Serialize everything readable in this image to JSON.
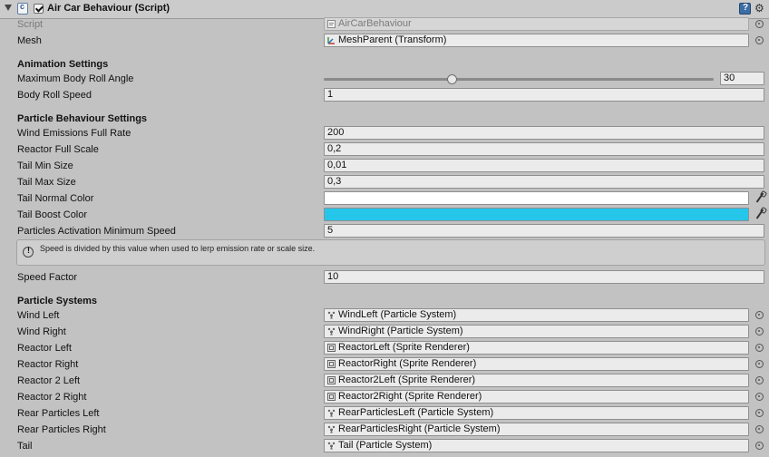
{
  "component": {
    "title": "Air Car Behaviour (Script)",
    "script_label": "Script",
    "script_value": "AirCarBehaviour",
    "mesh_label": "Mesh",
    "mesh_value": "MeshParent (Transform)"
  },
  "animation": {
    "header": "Animation Settings",
    "roll_angle_label": "Maximum Body Roll Angle",
    "roll_angle_value": "30",
    "roll_angle_slider_fraction": 0.33,
    "roll_speed_label": "Body Roll Speed",
    "roll_speed_value": "1"
  },
  "particle_behaviour": {
    "header": "Particle Behaviour Settings",
    "fields": [
      {
        "label": "Wind Emissions Full Rate",
        "value": "200"
      },
      {
        "label": "Reactor Full Scale",
        "value": "0,2"
      },
      {
        "label": "Tail Min Size",
        "value": "0,01"
      },
      {
        "label": "Tail Max Size",
        "value": "0,3"
      }
    ],
    "tail_normal_color_label": "Tail Normal Color",
    "tail_normal_color": "#ffffff",
    "tail_boost_color_label": "Tail Boost Color",
    "tail_boost_color": "#26c6eb",
    "activation_speed_label": "Particles Activation Minimum Speed",
    "activation_speed_value": "5",
    "help_text": "Speed is divided by this value when used to lerp emission rate or scale size.",
    "speed_factor_label": "Speed Factor",
    "speed_factor_value": "10"
  },
  "particle_systems": {
    "header": "Particle Systems",
    "items": [
      {
        "label": "Wind Left",
        "value": "WindLeft (Particle System)",
        "icon": "particle-system-icon"
      },
      {
        "label": "Wind Right",
        "value": "WindRight (Particle System)",
        "icon": "particle-system-icon"
      },
      {
        "label": "Reactor Left",
        "value": "ReactorLeft (Sprite Renderer)",
        "icon": "sprite-renderer-icon"
      },
      {
        "label": "Reactor Right",
        "value": "ReactorRight (Sprite Renderer)",
        "icon": "sprite-renderer-icon"
      },
      {
        "label": "Reactor 2 Left",
        "value": "Reactor2Left (Sprite Renderer)",
        "icon": "sprite-renderer-icon"
      },
      {
        "label": "Reactor 2 Right",
        "value": "Reactor2Right (Sprite Renderer)",
        "icon": "sprite-renderer-icon"
      },
      {
        "label": "Rear Particles Left",
        "value": "RearParticlesLeft (Particle System)",
        "icon": "particle-system-icon"
      },
      {
        "label": "Rear Particles Right",
        "value": "RearParticlesRight (Particle System)",
        "icon": "particle-system-icon"
      },
      {
        "label": "Tail",
        "value": "Tail (Particle System)",
        "icon": "particle-system-icon"
      }
    ]
  }
}
